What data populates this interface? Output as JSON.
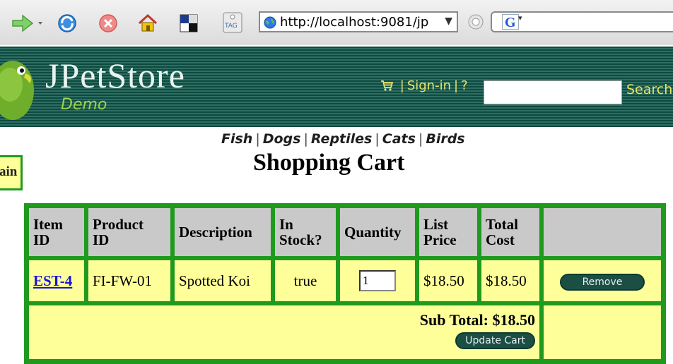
{
  "browser": {
    "address": "http://localhost:9081/jp",
    "address_drop": "▼",
    "google_logo": "G",
    "google_drop": "▾",
    "tag_label": "TAG",
    "icons": [
      "forward-icon",
      "refresh-icon",
      "stop-icon",
      "home-icon",
      "bookmark-icon",
      "tag-icon",
      "globe-icon",
      "go-icon"
    ]
  },
  "header": {
    "logo": "JPetStore",
    "subtitle": "Demo",
    "signin": "Sign-in",
    "help": "?",
    "search_label": "Search",
    "separator": "|"
  },
  "categories": [
    "Fish",
    "Dogs",
    "Reptiles",
    "Cats",
    "Birds"
  ],
  "category_separator": "|",
  "mainmenu_fragment": "ain",
  "title": "Shopping Cart",
  "table": {
    "headers": {
      "item_id": [
        "Item",
        "ID"
      ],
      "product_id": [
        "Product",
        "ID"
      ],
      "description": "Description",
      "in_stock": [
        "In",
        "Stock?"
      ],
      "quantity": "Quantity",
      "list_price": [
        "List",
        "Price"
      ],
      "total_cost": [
        "Total",
        "Cost"
      ]
    },
    "rows": [
      {
        "item_id": "EST-4",
        "product_id": "FI-FW-01",
        "description": "Spotted Koi",
        "in_stock": "true",
        "quantity": "1",
        "list_price": "$18.50",
        "total_cost": "$18.50",
        "remove_label": "Remove"
      }
    ],
    "subtotal": "Sub Total: $18.50",
    "update_label": "Update Cart"
  },
  "colors": {
    "header_dark": "#0d4a40",
    "header_stripe": "#2f6e63",
    "link_yellow": "#e8e36a",
    "demo_green": "#9ed34b",
    "table_border": "#1f9a1f",
    "cell_bg": "#ffff99",
    "header_cell_bg": "#c9c9c9",
    "link_blue": "#1515d8",
    "button_bg": "#1c4f44"
  }
}
